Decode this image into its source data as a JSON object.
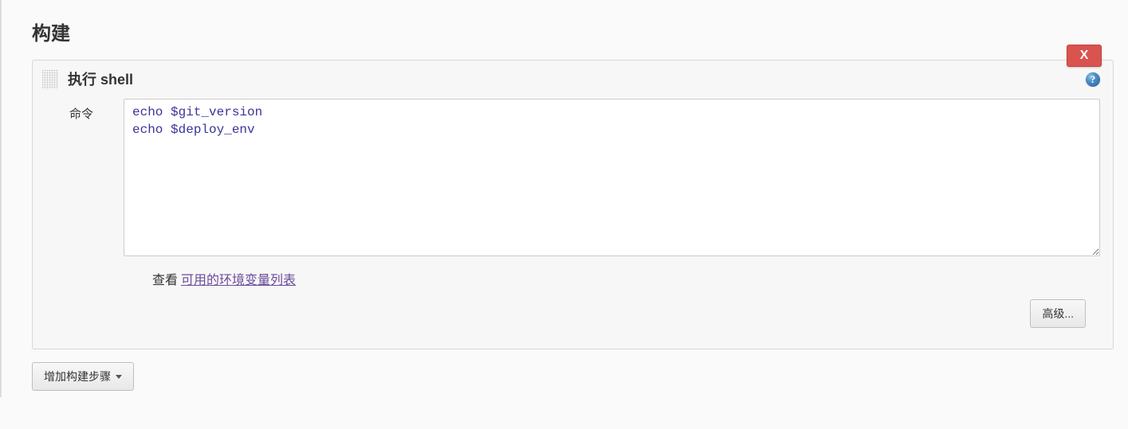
{
  "section": {
    "title": "构建"
  },
  "build_step": {
    "title": "执行 shell",
    "delete_label": "X",
    "help_glyph": "?",
    "command_label": "命令",
    "command_value": "echo $git_version\necho $deploy_env",
    "env_hint_prefix": "查看",
    "env_hint_link": "可用的环境变量列表",
    "advanced_label": "高级..."
  },
  "add_step": {
    "label": "增加构建步骤"
  }
}
